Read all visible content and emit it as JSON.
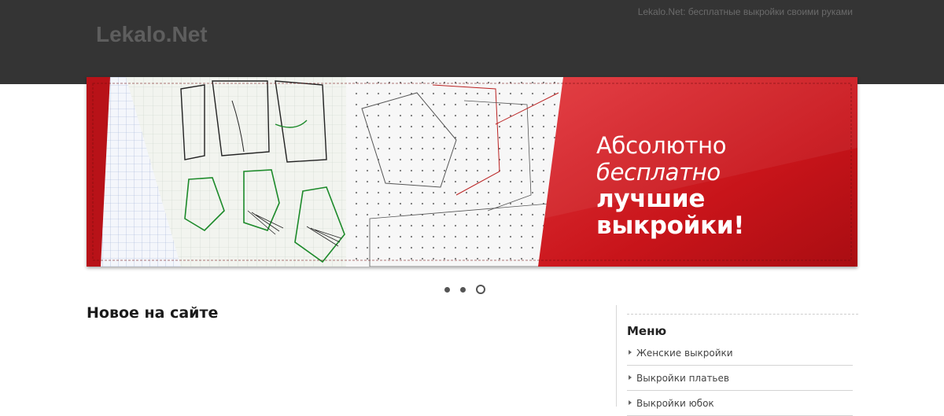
{
  "header": {
    "logo": "Lekalo.Net",
    "tagline": "Lekalo.Net: бесплатные выкройки своими руками"
  },
  "banner": {
    "line1": "Абсолютно",
    "line2": "бесплатно",
    "line3": "лучшие выкройки!",
    "accent_color": "#c5161b",
    "slides": 3,
    "active_slide": 3
  },
  "main": {
    "title": "Новое на сайте"
  },
  "sidebar": {
    "title": "Меню",
    "items": [
      {
        "label": "Женские выкройки"
      },
      {
        "label": "Выкройки платьев"
      },
      {
        "label": "Выкройки юбок"
      }
    ]
  }
}
